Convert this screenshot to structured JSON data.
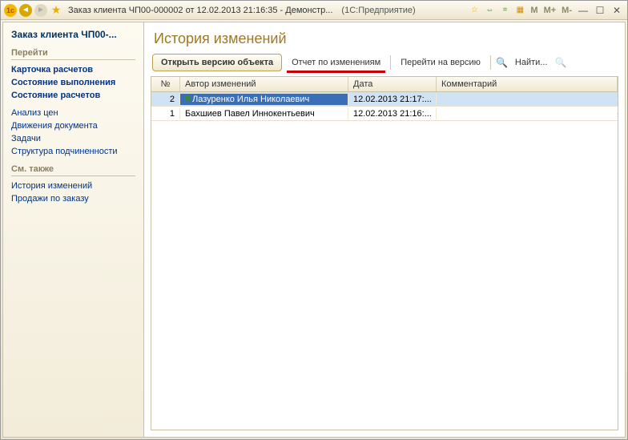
{
  "titlebar": {
    "title": "Заказ клиента ЧП00-000002 от 12.02.2013 21:16:35 - Демонстр...",
    "context": "(1С:Предприятие)",
    "m": "M",
    "mplus": "M+",
    "mminus": "M-"
  },
  "sidebar": {
    "title": "Заказ клиента ЧП00-...",
    "sec1": "Перейти",
    "links1": [
      {
        "label": "Карточка расчетов",
        "bold": true
      },
      {
        "label": "Состояние выполнения",
        "bold": true
      },
      {
        "label": "Состояние расчетов",
        "bold": true
      }
    ],
    "links2": [
      {
        "label": "Анализ цен"
      },
      {
        "label": "Движения документа"
      },
      {
        "label": "Задачи"
      },
      {
        "label": "Структура подчиненности"
      }
    ],
    "sec2": "См. также",
    "links3": [
      {
        "label": "История изменений"
      },
      {
        "label": "Продажи по заказу"
      }
    ]
  },
  "main": {
    "title": "История изменений",
    "toolbar": {
      "open": "Открыть версию объекта",
      "report": "Отчет по изменениям",
      "goto": "Перейти на версию",
      "find": "Найти..."
    },
    "columns": {
      "n": "№",
      "author": "Автор изменений",
      "date": "Дата",
      "comment": "Комментарий"
    },
    "rows": [
      {
        "n": "2",
        "author": "Лазуренко Илья Николаевич",
        "date": "12.02.2013 21:17:...",
        "comment": "",
        "selected": true
      },
      {
        "n": "1",
        "author": "Бахшиев Павел Иннокентьевич",
        "date": "12.02.2013 21:16:...",
        "comment": "",
        "selected": false
      }
    ]
  }
}
